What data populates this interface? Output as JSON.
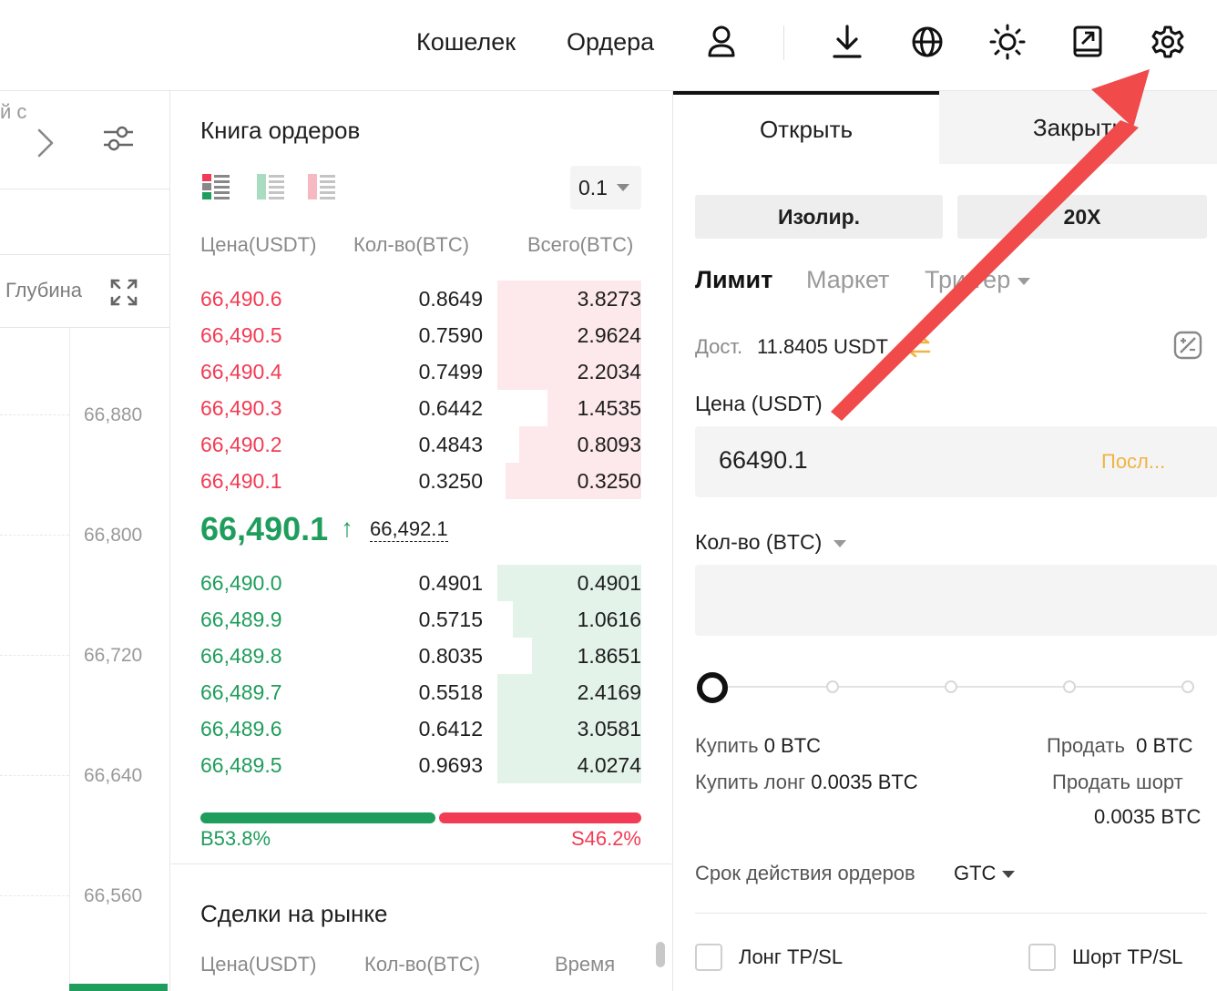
{
  "nav": {
    "wallet": "Кошелек",
    "orders": "Ордера",
    "icons": [
      "user-icon",
      "download-icon",
      "globe-icon",
      "theme-icon",
      "share-icon",
      "gear-icon"
    ]
  },
  "chart": {
    "cut_text": "й с",
    "depth": "Глубина",
    "axis": [
      "66,880",
      "66,800",
      "66,720",
      "66,640",
      "66,560"
    ]
  },
  "orderbook": {
    "title": "Книга ордеров",
    "precision": "0.1",
    "headers": {
      "price": "Цена(USDT)",
      "qty": "Кол-во(BTC)",
      "total": "Всего(BTC)"
    },
    "asks": [
      {
        "price": "66,490.6",
        "qty": "0.8649",
        "total": "3.8273",
        "depth": 0.95
      },
      {
        "price": "66,490.5",
        "qty": "0.7590",
        "total": "2.9624",
        "depth": 0.95
      },
      {
        "price": "66,490.4",
        "qty": "0.7499",
        "total": "2.2034",
        "depth": 0.95
      },
      {
        "price": "66,490.3",
        "qty": "0.6442",
        "total": "1.4535",
        "depth": 0.62
      },
      {
        "price": "66,490.2",
        "qty": "0.4843",
        "total": "0.8093",
        "depth": 0.81
      },
      {
        "price": "66,490.1",
        "qty": "0.3250",
        "total": "0.3250",
        "depth": 0.9
      }
    ],
    "last_price": "66,490.1",
    "mark_price": "66,492.1",
    "bids": [
      {
        "price": "66,490.0",
        "qty": "0.4901",
        "total": "0.4901",
        "depth": 0.95
      },
      {
        "price": "66,489.9",
        "qty": "0.5715",
        "total": "1.0616",
        "depth": 0.85
      },
      {
        "price": "66,489.8",
        "qty": "0.8035",
        "total": "1.8651",
        "depth": 0.72
      },
      {
        "price": "66,489.7",
        "qty": "0.5518",
        "total": "2.4169",
        "depth": 0.95
      },
      {
        "price": "66,489.6",
        "qty": "0.6412",
        "total": "3.0581",
        "depth": 0.95
      },
      {
        "price": "66,489.5",
        "qty": "0.9693",
        "total": "4.0274",
        "depth": 0.95
      }
    ],
    "buy_ratio": "B53.8%",
    "sell_ratio": "S46.2%",
    "buy_fraction": 0.538
  },
  "trades": {
    "title": "Сделки на рынке",
    "headers": {
      "price": "Цена(USDT)",
      "qty": "Кол-во(BTC)",
      "time": "Время"
    }
  },
  "trade_panel": {
    "tab_open": "Открыть",
    "tab_close": "Закрыть",
    "margin_mode": "Изолир.",
    "leverage": "20X",
    "order_types": {
      "limit": "Лимит",
      "market": "Маркет",
      "trigger": "Триггер"
    },
    "avail_label": "Дост.",
    "avail_value": "11.8405 USDT",
    "price_label": "Цена (USDT)",
    "price_value": "66490.1",
    "last_btn": "Посл...",
    "qty_label": "Кол-во (BTC)",
    "buy_label": "Купить",
    "buy_value": "0 BTC",
    "sell_label": "Продать",
    "sell_value": "0 BTC",
    "buy_long_label": "Купить лонг",
    "buy_long_value": "0.0035 BTC",
    "sell_short_label": "Продать шорт",
    "sell_short_value": "0.0035 BTC",
    "tif_label": "Срок действия ордеров",
    "tif_value": "GTC",
    "long_tpsl": "Лонг TP/SL",
    "short_tpsl": "Шорт TP/SL"
  },
  "colors": {
    "green": "#1f9d5c",
    "red": "#f23c55",
    "accent": "#f0b442",
    "arrow": "#f04a4a"
  }
}
